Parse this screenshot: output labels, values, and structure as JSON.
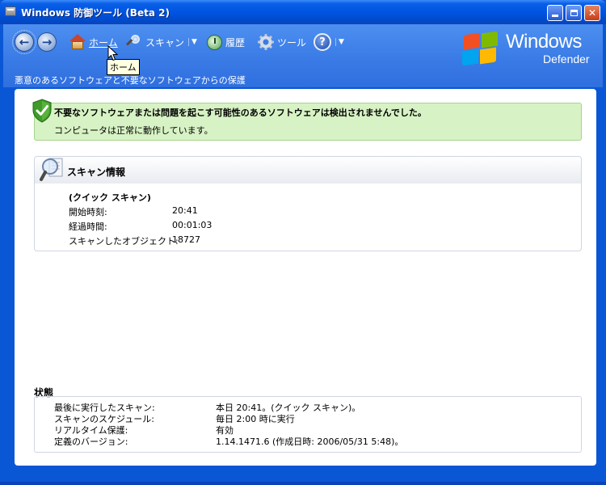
{
  "window": {
    "title": "Windows 防御ツール (Beta 2)"
  },
  "toolbar": {
    "back_glyph": "←",
    "forward_glyph": "→",
    "home_label": "ホーム",
    "scan_label": "スキャン",
    "history_label": "履歴",
    "tools_label": "ツール",
    "help_glyph": "?",
    "dropdown_glyph": "▼",
    "tooltip": "ホーム"
  },
  "header": {
    "subtitle": "悪意のあるソフトウェアと不要なソフトウェアからの保護",
    "logo_windows": "Windows",
    "logo_defender": "Defender"
  },
  "banner": {
    "title": "不要なソフトウェアまたは問題を起こす可能性のあるソフトウェアは検出されませんでした。",
    "subtitle": "コンピュータは正常に動作しています。"
  },
  "scan_info": {
    "title": "スキャン情報",
    "type": "(クイック スキャン)",
    "rows": [
      {
        "key": "開始時刻:",
        "value": "20:41"
      },
      {
        "key": "経過時間:",
        "value": "00:01:03"
      },
      {
        "key": "スキャンしたオブジェクト:",
        "value": "18727"
      }
    ]
  },
  "status": {
    "heading": "状態",
    "rows": [
      {
        "key": "最後に実行したスキャン:",
        "value": "本日 20:41。(クイック スキャン)。"
      },
      {
        "key": "スキャンのスケジュール:",
        "value": "毎日 2:00 時に実行"
      },
      {
        "key": "リアルタイム保護:",
        "value": "有効"
      },
      {
        "key": "定義のバージョン:",
        "value": "1.14.1471.6 (作成日時: 2006/05/31 5:48)。"
      }
    ]
  },
  "colors": {
    "titlebar": "#0054e3",
    "header": "#3a7be6",
    "banner_bg": "#d7f2c4",
    "banner_border": "#a7d48f"
  },
  "icons": [
    "window-app-icon",
    "back-arrow-icon",
    "forward-arrow-icon",
    "home-icon",
    "magnifier-icon",
    "history-icon",
    "gear-icon",
    "help-icon",
    "shield-check-icon",
    "scan-magnifier-icon",
    "windows-flag-logo"
  ]
}
